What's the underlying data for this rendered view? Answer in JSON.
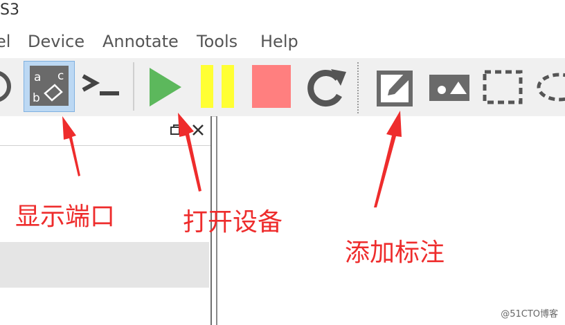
{
  "title_fragment": "S3",
  "menu": {
    "items": [
      "el",
      "Device",
      "Annotate",
      "Tools",
      "Help"
    ]
  },
  "toolbar": {
    "buttons": [
      {
        "name": "circle-partial-icon"
      },
      {
        "name": "show-interfaces-icon",
        "state": "active",
        "glyphs": [
          "a",
          "c",
          "b"
        ]
      },
      {
        "name": "console-icon",
        "glyph": ">_"
      },
      {
        "name": "play-icon",
        "color": "#5cb85c"
      },
      {
        "name": "pause-icon",
        "color": "#ffff33"
      },
      {
        "name": "stop-icon",
        "color": "#ff7f7f"
      },
      {
        "name": "reload-icon"
      },
      {
        "name": "add-note-icon"
      },
      {
        "name": "insert-picture-icon"
      },
      {
        "name": "draw-rectangle-icon"
      },
      {
        "name": "draw-ellipse-icon"
      }
    ]
  },
  "left_pane": {
    "header_buttons": [
      "restore-icon",
      "close-icon"
    ]
  },
  "annotations": {
    "show_ports": "显示端口",
    "open_device": "打开设备",
    "add_annotation": "添加标注"
  },
  "watermark": "@51CTO博客",
  "colors": {
    "arrow": "#ee2c2c",
    "play": "#5cb85c",
    "pause": "#ffff33",
    "stop": "#ff7f7f",
    "active_button_bg": "#bcd8f3"
  }
}
